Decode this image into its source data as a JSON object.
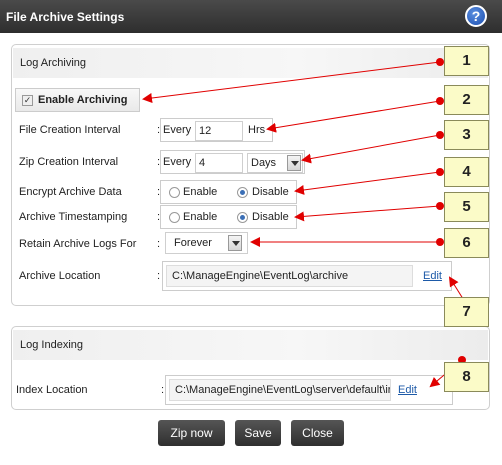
{
  "window": {
    "title": "File Archive Settings",
    "help_glyph": "?"
  },
  "log_archiving": {
    "section_title": "Log Archiving",
    "enable_archiving_label": "Enable Archiving",
    "enable_archiving_checked": true,
    "file_creation": {
      "label": "File Creation Interval",
      "prefix": "Every",
      "value": "12",
      "unit": "Hrs"
    },
    "zip_creation": {
      "label": "Zip Creation Interval",
      "prefix": "Every",
      "value": "4",
      "unit": "Days"
    },
    "encrypt": {
      "label": "Encrypt Archive Data",
      "option_enable": "Enable",
      "option_disable": "Disable",
      "selected": "Disable"
    },
    "timestamping": {
      "label": "Archive Timestamping",
      "option_enable": "Enable",
      "option_disable": "Disable",
      "selected": "Disable"
    },
    "retain": {
      "label": "Retain Archive Logs For",
      "value": "Forever"
    },
    "location": {
      "label": "Archive Location",
      "value": "C:\\ManageEngine\\EventLog\\archive",
      "edit_label": "Edit"
    }
  },
  "log_indexing": {
    "section_title": "Log Indexing",
    "location": {
      "label": "Index Location",
      "value": "C:\\ManageEngine\\EventLog\\server\\default\\ir",
      "edit_label": "Edit"
    }
  },
  "colon": ":",
  "buttons": {
    "zip_now": "Zip now",
    "save": "Save",
    "close": "Close"
  },
  "callouts": [
    "1",
    "2",
    "3",
    "4",
    "5",
    "6",
    "7",
    "8"
  ],
  "colors": {
    "titlebar": "#3a3a3a",
    "callout_fill": "#fbfbc8",
    "arrow": "#e00000",
    "link": "#1d5aa8"
  }
}
